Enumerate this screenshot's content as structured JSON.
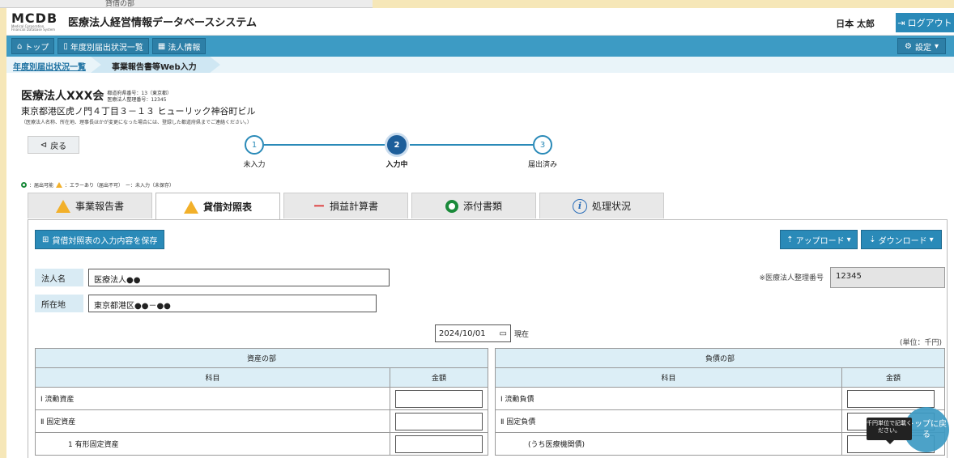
{
  "background_text": "貸借の部",
  "header": {
    "logo": "MCDB",
    "logo_sub": "Medical Corporation Financial Database System",
    "system_title": "医療法人経営情報データベースシステム",
    "username": "日本 太郎",
    "logout_label": "ログアウト"
  },
  "nav": {
    "top_label": "トップ",
    "yearly_label": "年度別届出状況一覧",
    "corp_label": "法人情報",
    "settings_label": "設定"
  },
  "breadcrumb": {
    "item1": "年度別届出状況一覧",
    "item2": "事業報告書等Web入力"
  },
  "org": {
    "name": "医療法人XXX会",
    "prefecture_no": "都道府県番号：13（東京都）",
    "corp_no": "医療法人整理番号：12345",
    "address": "東京都港区虎ノ門４丁目３－１３ ヒューリック神谷町ビル",
    "note": "（医療法人名称、所在地、理事長ほかが変更になった場合には、登録した都道府県までご連絡ください。）"
  },
  "back_label": "戻る",
  "stepper": {
    "steps": [
      {
        "num": "1",
        "label": "未入力"
      },
      {
        "num": "2",
        "label": "入力中"
      },
      {
        "num": "3",
        "label": "届出済み"
      }
    ]
  },
  "legend": {
    "ok": "：届出可能",
    "error": "：エラーあり（届出不可）",
    "unsaved": "ー：未入力（未保存）"
  },
  "tabs": [
    {
      "label": "事業報告書"
    },
    {
      "label": "貸借対照表"
    },
    {
      "label": "損益計算書"
    },
    {
      "label": "添付書類"
    },
    {
      "label": "処理状況"
    }
  ],
  "toolbar": {
    "save_label": "貸借対照表の入力内容を保存",
    "upload_label": "アップロード",
    "download_label": "ダウンロード"
  },
  "form": {
    "corp_name_label": "法人名",
    "corp_name_value": "医療法人●●",
    "address_label": "所在地",
    "address_value": "東京都港区●●－●●",
    "reg_label": "※医療法人整理番号",
    "reg_value": "12345",
    "date_value": "2024/10/01",
    "date_suffix": "現在",
    "unit": "(単位：千円)"
  },
  "assets": {
    "title": "資産の部",
    "col_item": "科目",
    "col_amount": "金額",
    "rows": [
      "Ⅰ 流動資産",
      "Ⅱ 固定資産",
      "1 有形固定資産"
    ]
  },
  "liabilities": {
    "title": "負債の部",
    "col_item": "科目",
    "col_amount": "金額",
    "rows": [
      "Ⅰ 流動負債",
      "Ⅱ 固定負債",
      "(うち医療機関債)"
    ]
  },
  "tooltip": "千円単位で記載ください。",
  "top_float": "トップに戻る",
  "colors": {
    "primary": "#2a8ab8",
    "nav": "#3d9bc4",
    "warning": "#f2b02a",
    "ok": "#1a8a3a",
    "outer_bg": "#f6e7b8"
  }
}
